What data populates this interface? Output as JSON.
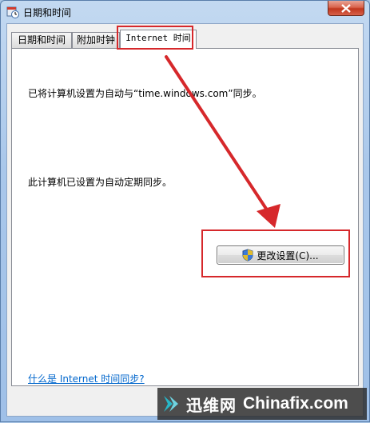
{
  "window": {
    "title": "日期和时间"
  },
  "tabs": [
    {
      "label": "日期和时间"
    },
    {
      "label": "附加时钟"
    },
    {
      "label": "Internet 时间"
    }
  ],
  "panel": {
    "sync_text": "已将计算机设置为自动与“time.windows.com”同步。",
    "auto_text": "此计算机已设置为自动定期同步。",
    "change_button_label": "更改设置(C)...",
    "help_link": "什么是 Internet 时间同步?"
  },
  "watermark": {
    "brand": "迅维网",
    "site": "Chinafix.com"
  },
  "colors": {
    "highlight_red": "#d6282b",
    "link_blue": "#0066cc"
  }
}
